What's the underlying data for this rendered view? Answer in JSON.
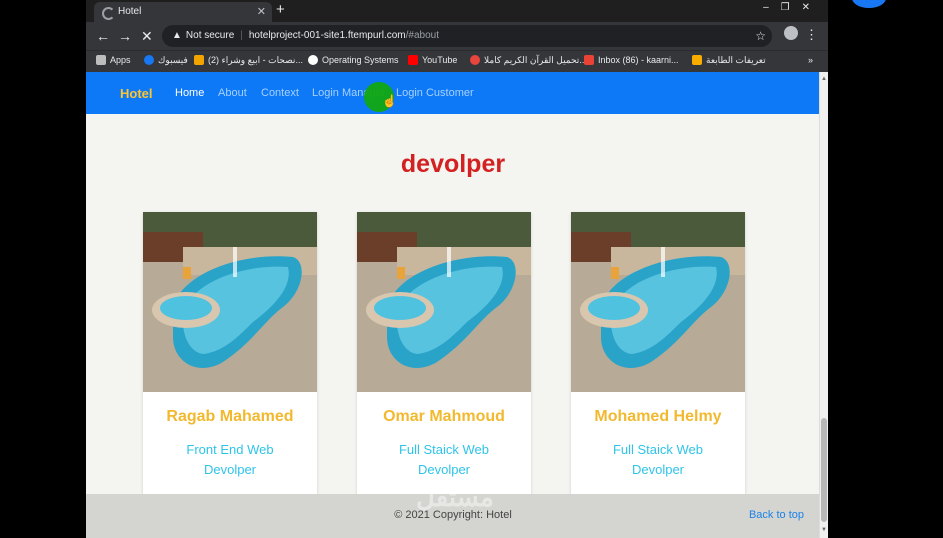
{
  "browser": {
    "tab_title": "Hotel",
    "new_tab_symbol": "+",
    "url_warning": "Not secure",
    "url_host": "hotelproject-001-site1.ftempurl.com",
    "url_hash": "/#about",
    "bookmarks": [
      {
        "label": "Apps",
        "color": "#bdbdbd"
      },
      {
        "label": "فيسبوك",
        "color": "#1877f2"
      },
      {
        "label": "(2) نصحات - ابيع وشراء...",
        "color": "#f4a400"
      },
      {
        "label": "Operating Systems",
        "color": "#ffffff"
      },
      {
        "label": "YouTube",
        "color": "#ff0000"
      },
      {
        "label": "تحميل القرآن الكريم كاملا...",
        "color": "#e8453c"
      },
      {
        "label": "Inbox (86) - kaarni...",
        "color": "#ea4335"
      },
      {
        "label": "تعريفات الطابعة",
        "color": "#f9ab00"
      }
    ],
    "bookmarks_more": "»"
  },
  "site": {
    "brand": "Hotel",
    "nav": [
      {
        "label": "Home",
        "active": true
      },
      {
        "label": "About",
        "active": false
      },
      {
        "label": "Context",
        "active": false
      },
      {
        "label": "Login Manager",
        "active": false
      },
      {
        "label": "Login Customer",
        "active": false
      }
    ],
    "heading": "devolper",
    "cards": [
      {
        "name": "Ragab Mahamed",
        "role": "Front End Web Devolper"
      },
      {
        "name": "Omar Mahmoud",
        "role": "Full Staick Web Devolper"
      },
      {
        "name": "Mohamed Helmy",
        "role": "Full Staick Web Devolper"
      }
    ],
    "footer_text": "© 2021 Copyright: Hotel",
    "back_to_top": "Back to top",
    "watermark": "مستقل"
  },
  "colors": {
    "navbar": "#0d79f7",
    "brand": "#ffc52c",
    "heading": "#d32020",
    "card_name": "#f2b92f",
    "card_role": "#2ec4ea",
    "page_bg": "#f4f4f0"
  }
}
